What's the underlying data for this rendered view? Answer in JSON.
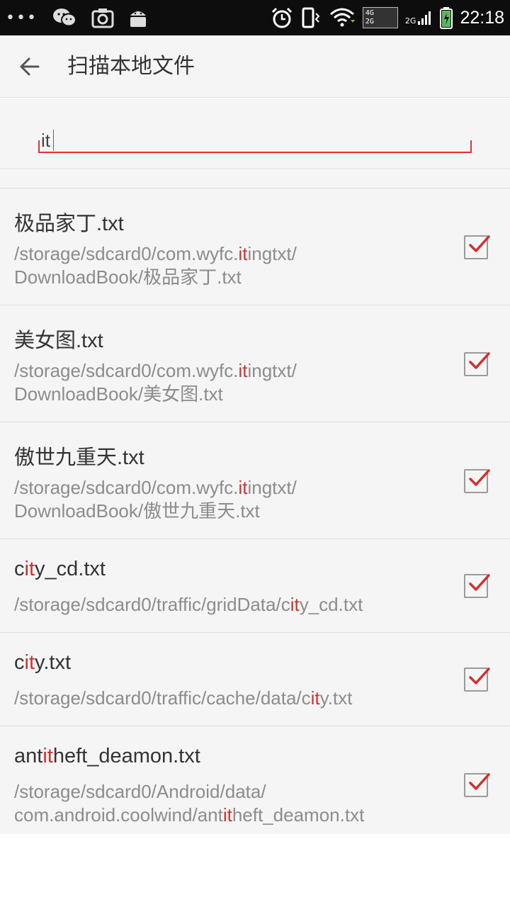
{
  "status_bar": {
    "dots": "•••",
    "net_4g": "4G",
    "net_2g": "2G",
    "net_2g_small": "2G",
    "time": "22:18",
    "icons": [
      "wechat-icon",
      "camera-icon",
      "android-icon",
      "alarm-icon",
      "vibrate-icon",
      "wifi-icon",
      "signal-icon",
      "battery-icon"
    ]
  },
  "app_bar": {
    "back_icon": "arrow-left-icon",
    "title": "扫描本地文件"
  },
  "search": {
    "value": "it",
    "accent_color": "#d33333"
  },
  "files": [
    {
      "name": [
        "极品家丁.txt"
      ],
      "name_hl": [],
      "path_lines": [
        [
          "/storage/sdcard0/com.wyfc.",
          "it",
          "ingtxt/"
        ],
        [
          "DownloadBook/极品家丁.txt"
        ]
      ],
      "checked": true
    },
    {
      "name": [
        "美女图.txt"
      ],
      "name_hl": [],
      "path_lines": [
        [
          "/storage/sdcard0/com.wyfc.",
          "it",
          "ingtxt/"
        ],
        [
          "DownloadBook/美女图.txt"
        ]
      ],
      "checked": true
    },
    {
      "name": [
        "傲世九重天.txt"
      ],
      "name_hl": [],
      "path_lines": [
        [
          "/storage/sdcard0/com.wyfc.",
          "it",
          "ingtxt/"
        ],
        [
          "DownloadBook/傲世九重天.txt"
        ]
      ],
      "checked": true
    },
    {
      "name": [
        "c",
        "it",
        "y_cd.txt"
      ],
      "path_lines": [
        [
          "/storage/sdcard0/traffic/gridData/c",
          "it",
          "y_cd.txt"
        ]
      ],
      "checked": true
    },
    {
      "name": [
        "c",
        "it",
        "y.txt"
      ],
      "path_lines": [
        [
          "/storage/sdcard0/traffic/cache/data/c",
          "it",
          "y.txt"
        ]
      ],
      "checked": true
    },
    {
      "name": [
        "ant",
        "it",
        "heft_deamon.txt"
      ],
      "path_lines": [
        [
          "/storage/sdcard0/Android/data/"
        ],
        [
          "com.android.coolwind/ant",
          "it",
          "heft_deamon.txt"
        ]
      ],
      "checked": true
    }
  ],
  "colors": {
    "highlight": "#d32f2f",
    "check": "#d32f2f",
    "row_bg": "#f5f5f5"
  }
}
